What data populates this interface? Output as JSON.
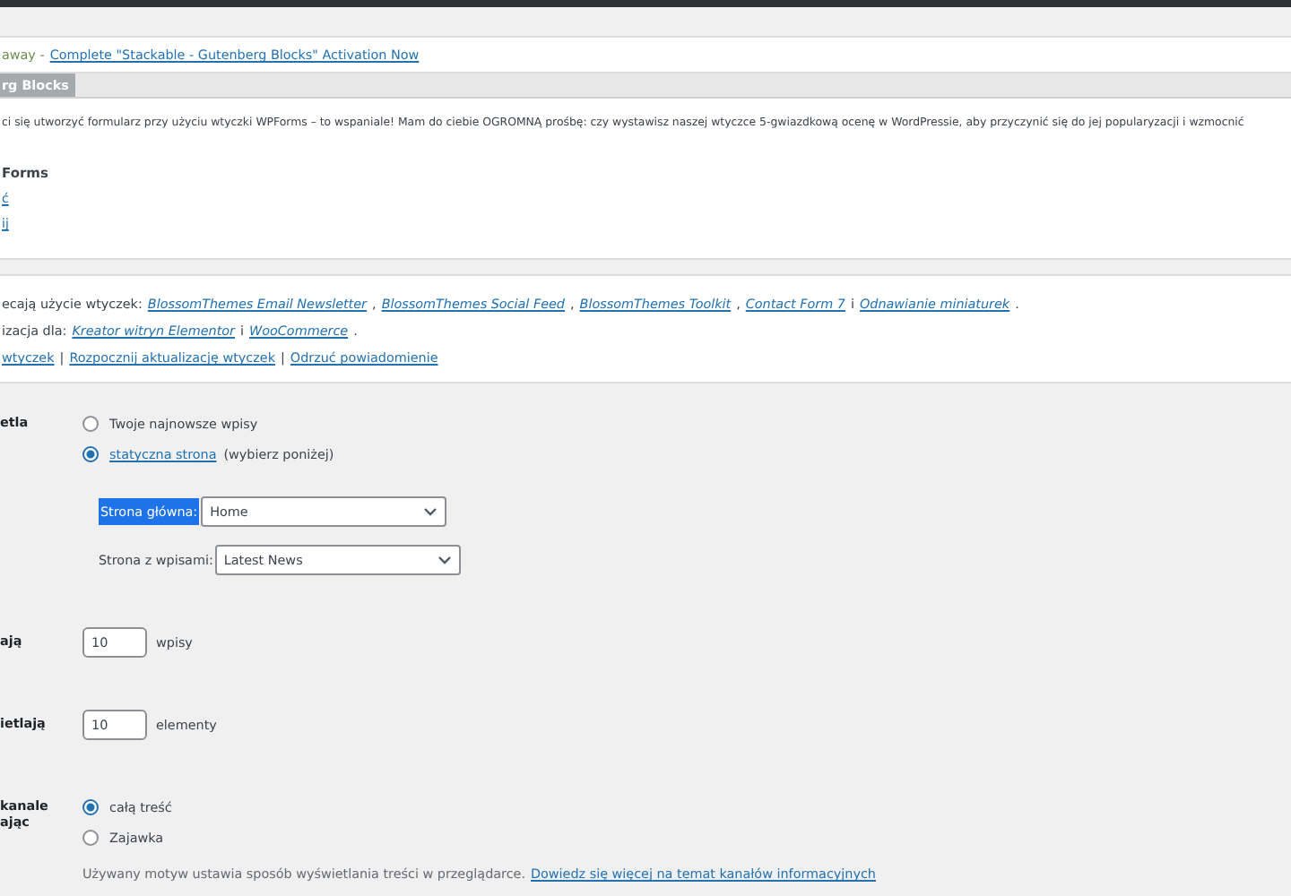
{
  "notice_top": {
    "text": "away -",
    "link": "Complete \"Stackable - Gutenberg Blocks\" Activation Now"
  },
  "review_notice": {
    "header": "rg Blocks",
    "message": "ci się utworzyć formularz przy użyciu wtyczki WPForms – to wspaniale! Mam do ciebie OGROMNĄ prośbę: czy wystawisz naszej wtyczce 5-gwiazdkową ocenę w WordPressie, aby przyczynić się do jej popularyzacji i wzmocnić",
    "signature": "Forms",
    "links": [
      "ć",
      "ij"
    ]
  },
  "plugin_notice": {
    "lines": [
      {
        "parts": [
          {
            "kind": "text",
            "text": "ecają użycie wtyczek:"
          },
          {
            "kind": "link",
            "text": "BlossomThemes Email Newsletter"
          },
          {
            "kind": "text",
            "text": ","
          },
          {
            "kind": "link",
            "text": "BlossomThemes Social Feed"
          },
          {
            "kind": "text",
            "text": ","
          },
          {
            "kind": "link",
            "text": "BlossomThemes Toolkit"
          },
          {
            "kind": "text",
            "text": ","
          },
          {
            "kind": "link",
            "text": "Contact Form 7"
          },
          {
            "kind": "text",
            "text": "i"
          },
          {
            "kind": "link",
            "text": "Odnawianie miniaturek"
          },
          {
            "kind": "text",
            "text": "."
          }
        ]
      },
      {
        "parts": [
          {
            "kind": "text",
            "text": "izacja dla:"
          },
          {
            "kind": "link",
            "text": "Kreator witryn Elementor"
          },
          {
            "kind": "text",
            "text": "i"
          },
          {
            "kind": "link",
            "text": "WooCommerce"
          },
          {
            "kind": "text",
            "text": "."
          }
        ]
      },
      {
        "parts": [
          {
            "kind": "action",
            "text": "wtyczek"
          },
          {
            "kind": "text",
            "text": "|"
          },
          {
            "kind": "action",
            "text": "Rozpocznij aktualizację wtyczek"
          },
          {
            "kind": "text",
            "text": "|"
          },
          {
            "kind": "action",
            "text": "Odrzuć powiadomienie"
          }
        ]
      }
    ]
  },
  "settings": [
    {
      "kind": "homepage",
      "label": "etla",
      "options": [
        {
          "text": "Twoje najnowsze wpisy",
          "selected": false
        },
        {
          "text": "statyczna strona",
          "suffix": "(wybierz poniżej)",
          "selected": true
        }
      ],
      "selects": [
        {
          "label": "Strona główna:",
          "highlighted": true,
          "value": "Home"
        },
        {
          "label": "Strona z wpisami:",
          "highlighted": false,
          "value": "Latest News"
        }
      ]
    },
    {
      "kind": "number",
      "label": "ają",
      "value": "10",
      "unit": "wpisy"
    },
    {
      "kind": "number",
      "label": "ietlają",
      "value": "10",
      "unit": "elementy"
    },
    {
      "kind": "feed",
      "label": [
        "kanale",
        "ając"
      ],
      "options": [
        {
          "text": "całą treść",
          "selected": true
        },
        {
          "text": "Zajawka",
          "selected": false
        }
      ],
      "description": "Używany motyw ustawia sposób wyświetlania treści w przeglądarce.",
      "link": "Dowiedz się więcej na temat kanałów informacyjnych"
    }
  ]
}
